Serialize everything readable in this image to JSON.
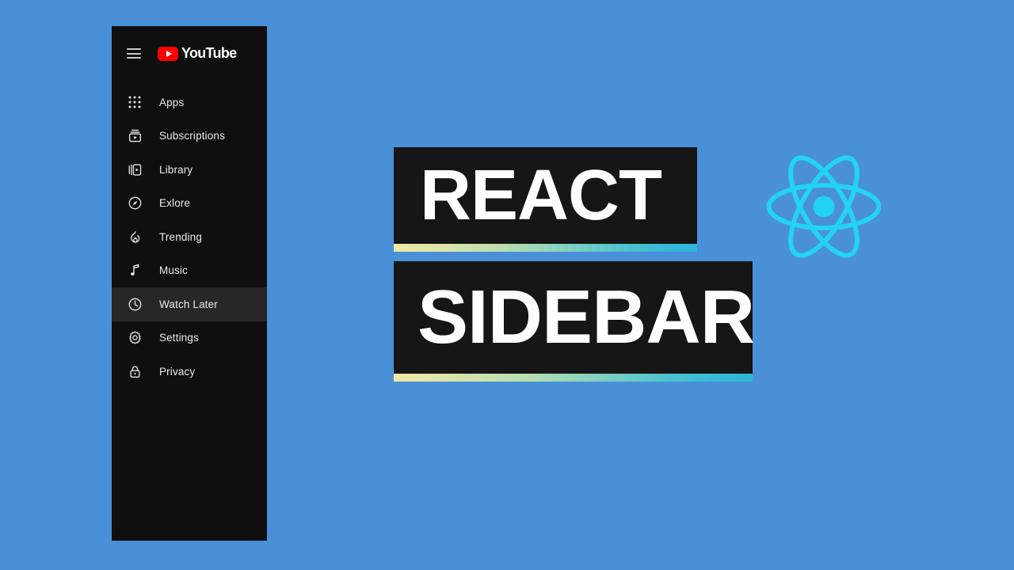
{
  "background_color": "#4a90d9",
  "sidebar": {
    "background_color": "#0f0f0f",
    "active_background_color": "#272727",
    "brand": {
      "menu_icon": "hamburger-menu-icon",
      "logo_icon": "youtube-play-icon",
      "logo_text": "YouTube",
      "logo_color": "#ff0000"
    },
    "items": [
      {
        "icon": "apps-grid-icon",
        "label": "Apps",
        "active": false
      },
      {
        "icon": "subscriptions-icon",
        "label": "Subscriptions",
        "active": false
      },
      {
        "icon": "library-icon",
        "label": "Library",
        "active": false
      },
      {
        "icon": "compass-explore-icon",
        "label": "Exlore",
        "active": false
      },
      {
        "icon": "flame-trending-icon",
        "label": "Trending",
        "active": false
      },
      {
        "icon": "music-note-icon",
        "label": "Music",
        "active": false
      },
      {
        "icon": "clock-icon",
        "label": "Watch Later",
        "active": true
      },
      {
        "icon": "gear-settings-icon",
        "label": "Settings",
        "active": false
      },
      {
        "icon": "lock-privacy-icon",
        "label": "Privacy",
        "active": false
      }
    ]
  },
  "title": {
    "line1": "REACT",
    "line2": "SIDEBAR",
    "box_color": "#161616",
    "text_color": "#ffffff",
    "underline_gradient_start": "#efe8a6",
    "underline_gradient_end": "#2fb6d6"
  },
  "react_logo": {
    "icon": "react-atom-logo-icon",
    "color": "#22d3f5"
  }
}
